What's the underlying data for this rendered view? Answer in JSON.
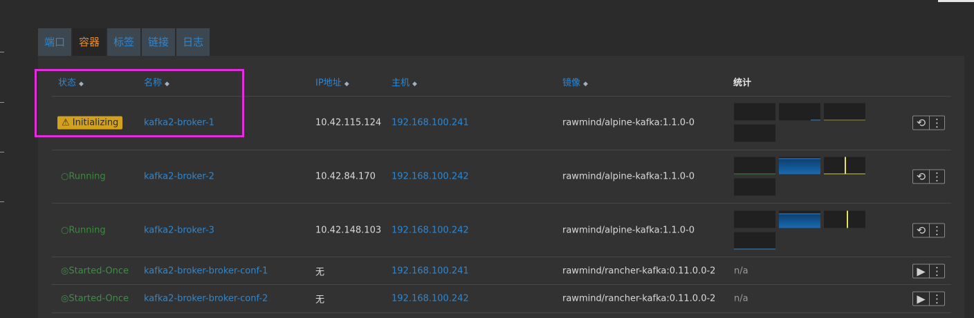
{
  "tabs": [
    {
      "label": "端口",
      "active": false
    },
    {
      "label": "容器",
      "active": true
    },
    {
      "label": "标签",
      "active": false
    },
    {
      "label": "链接",
      "active": false
    },
    {
      "label": "日志",
      "active": false
    }
  ],
  "table": {
    "headers": {
      "state": "状态",
      "name": "名称",
      "ip": "IP地址",
      "host": "主机",
      "image": "镜像",
      "stats": "统计"
    },
    "rows": [
      {
        "state": "Initializing",
        "state_kind": "initializing",
        "name": "kafka2-broker-1",
        "ip": "10.42.115.124",
        "host": "192.168.100.241",
        "image": "rawmind/alpine-kafka:1.1.0-0",
        "stats": "",
        "action": "restart-icon"
      },
      {
        "state": "Running",
        "state_kind": "running",
        "name": "kafka2-broker-2",
        "ip": "10.42.84.170",
        "host": "192.168.100.242",
        "image": "rawmind/alpine-kafka:1.1.0-0",
        "stats": "",
        "action": "restart-icon"
      },
      {
        "state": "Running",
        "state_kind": "running",
        "name": "kafka2-broker-3",
        "ip": "10.42.148.103",
        "host": "192.168.100.242",
        "image": "rawmind/alpine-kafka:1.1.0-0",
        "stats": "",
        "action": "restart-icon"
      },
      {
        "state": "Started-Once",
        "state_kind": "started-once",
        "name": "kafka2-broker-broker-conf-1",
        "ip": "无",
        "host": "192.168.100.241",
        "image": "rawmind/rancher-kafka:0.11.0.0-2",
        "stats": "n/a",
        "action": "play-icon"
      },
      {
        "state": "Started-Once",
        "state_kind": "started-once",
        "name": "kafka2-broker-broker-conf-2",
        "ip": "无",
        "host": "192.168.100.242",
        "image": "rawmind/rancher-kafka:0.11.0.0-2",
        "stats": "n/a",
        "action": "play-icon"
      }
    ]
  },
  "colors": {
    "accent_link": "#2f87cf",
    "active_tab": "#f08a1c",
    "initializing_badge": "#d3a11e",
    "running": "#3c8a3c",
    "highlight_box": "#e22ddd"
  }
}
